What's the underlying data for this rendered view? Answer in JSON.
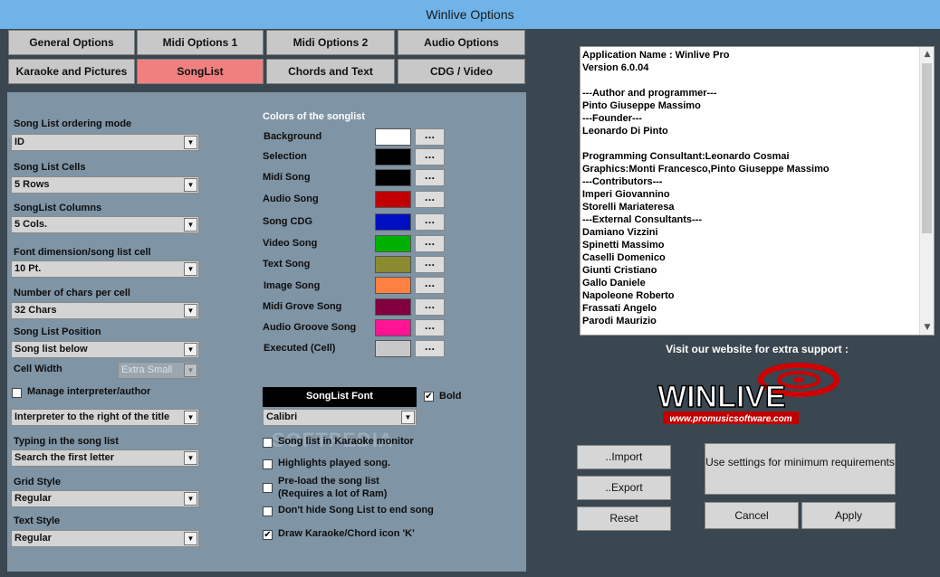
{
  "window": {
    "title": "Winlive  Options"
  },
  "tabs": [
    {
      "label": "General Options"
    },
    {
      "label": "Midi Options 1"
    },
    {
      "label": "Midi Options 2"
    },
    {
      "label": "Audio Options"
    },
    {
      "label": "Karaoke and Pictures"
    },
    {
      "label": "SongList",
      "active": true
    },
    {
      "label": "Chords and Text"
    },
    {
      "label": "CDG / Video"
    }
  ],
  "left": {
    "ordering_label": "Song List ordering mode",
    "ordering_value": "ID",
    "cells_label": "Song List Cells",
    "cells_value": "5 Rows",
    "columns_label": "SongList Columns",
    "columns_value": "5 Cols.",
    "fontdim_label": "Font dimension/song list cell",
    "fontdim_value": "10 Pt.",
    "chars_label": "Number of chars per cell",
    "chars_value": "32 Chars",
    "position_label": "Song List Position",
    "position_value": "Song list below",
    "cellwidth_label": "Cell Width",
    "cellwidth_value": "Extra Small",
    "manage_label": "Manage interpreter/author",
    "interpreter_value": "Interpreter to the right of the title",
    "typing_label": "Typing in the song list",
    "typing_value": "Search the first letter",
    "grid_label": "Grid Style",
    "grid_value": "Regular",
    "textstyle_label": "Text Style",
    "textstyle_value": "Regular"
  },
  "colors": {
    "header": "Colors of the songlist",
    "items": [
      {
        "label": "Background",
        "color": "#ffffff"
      },
      {
        "label": "Selection",
        "color": "#000000"
      },
      {
        "label": "Midi Song",
        "color": "#000000"
      },
      {
        "label": "Audio Song",
        "color": "#c00000"
      },
      {
        "label": "Song CDG",
        "color": "#0010c0"
      },
      {
        "label": "Video Song",
        "color": "#00b000"
      },
      {
        "label": "Text Song",
        "color": "#8a8a30"
      },
      {
        "label": "Image Song",
        "color": "#ff8040"
      },
      {
        "label": "Midi Grove Song",
        "color": "#800040"
      },
      {
        "label": "Audio Groove Song",
        "color": "#ff1493"
      },
      {
        "label": "Executed (Cell)",
        "color": "#c8c8c8"
      }
    ],
    "dots_label": "..."
  },
  "font": {
    "box_label": "SongList Font",
    "bold_label": "Bold",
    "font_value": "Calibri"
  },
  "options": {
    "karaoke_monitor": "Song list in Karaoke monitor",
    "highlights": "Highlights played song.",
    "preload_1": "Pre-load the song list",
    "preload_2": "(Requires a lot of Ram)",
    "dont_hide": "Don't hide Song List to end song",
    "draw_icon": "Draw Karaoke/Chord icon 'K'"
  },
  "info": {
    "lines": [
      "Application Name : Winlive Pro",
      "Version 6.0.04",
      "",
      "---Author and programmer---",
      "Pinto Giuseppe Massimo",
      "---Founder---",
      "Leonardo Di Pinto",
      "",
      "Programming Consultant:Leonardo Cosmai",
      "Graphics:Monti Francesco,Pinto Giuseppe Massimo",
      "---Contributors---",
      "Imperi Giovannino",
      "Storelli Mariateresa",
      "---External Consultants---",
      "Damiano Vizzini",
      "Spinetti Massimo",
      "Caselli Domenico",
      "Giunti Cristiano",
      "Gallo Daniele",
      "Napoleone Roberto",
      "Frassati Angelo",
      "Parodi Maurizio"
    ]
  },
  "support": {
    "visit_text": "Visit our website for extra support :",
    "logo_text": "WINLIVE",
    "logo_url_text": "www.promusicsoftware.com"
  },
  "buttons": {
    "import": "..Import",
    "export": "..Export",
    "reset": "Reset",
    "min_req": "Use settings for minimum requirements",
    "cancel": "Cancel",
    "apply": "Apply"
  },
  "watermark": "SOFTPEDIA"
}
